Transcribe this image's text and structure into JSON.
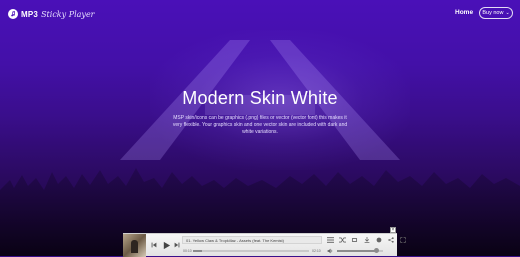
{
  "nav": {
    "logo_text": "MP3",
    "logo_script": "Sticky Player",
    "home_label": "Home",
    "buy_label": "Buy now",
    "buy_chevron": "⌄"
  },
  "hero": {
    "title": "Modern Skin White",
    "description": "MSP skin/icons can be graphics (.png) files or vector (vector font) this makes it very flexible. Your graphics skin and one vector skin are included with dark and white variations."
  },
  "player": {
    "track_title": "01. Yellow Claw & Tropkillaz - Assets (feat. The Kemist)",
    "time_elapsed": "00:10",
    "time_total": "02:10",
    "progress": 0.08,
    "volume": 0.85,
    "close_label": "×"
  },
  "colors": {
    "accent": "#4a10b8",
    "player_bg": "#efefef"
  }
}
